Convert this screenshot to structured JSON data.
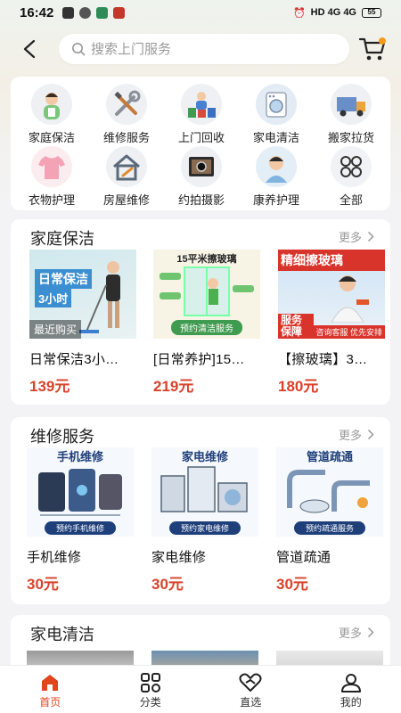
{
  "status_bar": {
    "time": "16:42",
    "network": "HD 4G 4G",
    "battery": "55"
  },
  "search": {
    "placeholder": "搜索上门服务"
  },
  "categories": [
    {
      "label": "家庭保洁",
      "icon": "cleaner-icon"
    },
    {
      "label": "维修服务",
      "icon": "tools-icon"
    },
    {
      "label": "上门回收",
      "icon": "recycle-icon"
    },
    {
      "label": "家电清洁",
      "icon": "washing-machine-icon"
    },
    {
      "label": "搬家拉货",
      "icon": "truck-icon"
    },
    {
      "label": "衣物护理",
      "icon": "tshirt-icon"
    },
    {
      "label": "房屋维修",
      "icon": "house-icon"
    },
    {
      "label": "约拍摄影",
      "icon": "camera-icon"
    },
    {
      "label": "康养护理",
      "icon": "nurse-icon"
    },
    {
      "label": "全部",
      "icon": "grid-icon"
    }
  ],
  "sections": [
    {
      "title": "家庭保洁",
      "more": "更多",
      "products": [
        {
          "name": "日常保洁3小…",
          "price": "139元",
          "img_title": "日常保洁",
          "img_sub": "3小时",
          "img_badge": "最近购买"
        },
        {
          "name": "[日常养护]15…",
          "price": "219元",
          "img_title": "15平米擦玻璃",
          "img_sub": "预约清洁服务"
        },
        {
          "name": "【擦玻璃】3…",
          "price": "180元",
          "img_title": "精细擦玻璃",
          "img_sub": "服务保障",
          "img_badge": "咨询客服 优先安排"
        }
      ]
    },
    {
      "title": "维修服务",
      "more": "更多",
      "products": [
        {
          "name": "手机维修",
          "price": "30元",
          "img_title": "手机维修",
          "img_sub": "预约手机维修"
        },
        {
          "name": "家电维修",
          "price": "30元",
          "img_title": "家电维修",
          "img_sub": "预约家电维修"
        },
        {
          "name": "管道疏通",
          "price": "30元",
          "img_title": "管道疏通",
          "img_sub": "预约疏通服务"
        }
      ]
    },
    {
      "title": "家电清洁",
      "more": "更多"
    }
  ],
  "tabbar": [
    {
      "label": "首页",
      "icon": "home-icon",
      "active": true
    },
    {
      "label": "分类",
      "icon": "category-icon"
    },
    {
      "label": "直选",
      "icon": "heart-hand-icon"
    },
    {
      "label": "我的",
      "icon": "user-icon"
    }
  ],
  "colors": {
    "accent": "#e0451c",
    "price": "#d8412a"
  }
}
